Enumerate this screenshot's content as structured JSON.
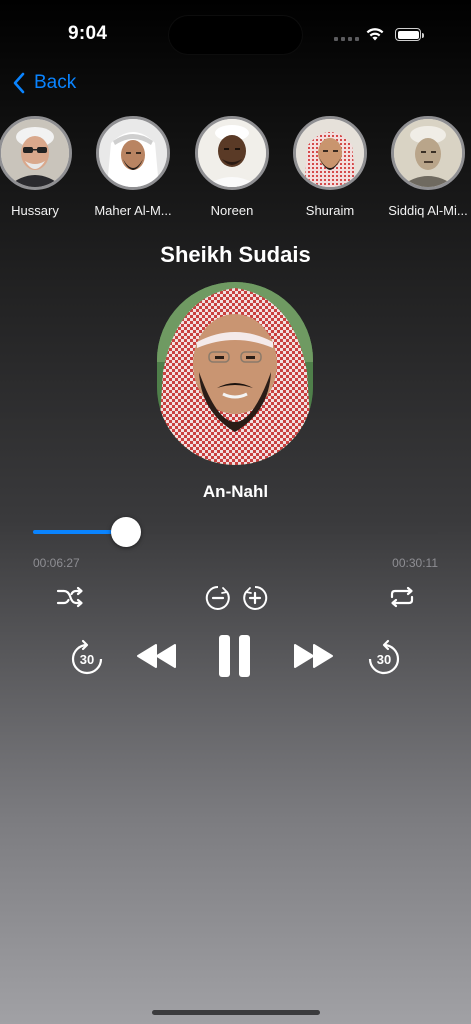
{
  "status_bar": {
    "time": "9:04",
    "battery_level": 1.0
  },
  "nav": {
    "back_label": "Back"
  },
  "reciters": [
    {
      "name": "Hussary"
    },
    {
      "name": "Maher Al-M..."
    },
    {
      "name": "Noreen"
    },
    {
      "name": "Shuraim"
    },
    {
      "name": "Siddiq Al-Mi..."
    }
  ],
  "player": {
    "reciter": "Sheikh Sudais",
    "surah": "An-Nahl",
    "elapsed": "00:06:27",
    "total": "00:30:11",
    "progress": 0.23,
    "skip_back_seconds": "30",
    "skip_forward_seconds": "30",
    "state": "playing"
  },
  "colors": {
    "accent": "#0a84ff",
    "track": "#3c3c3e",
    "text_secondary": "#8e8e93"
  }
}
